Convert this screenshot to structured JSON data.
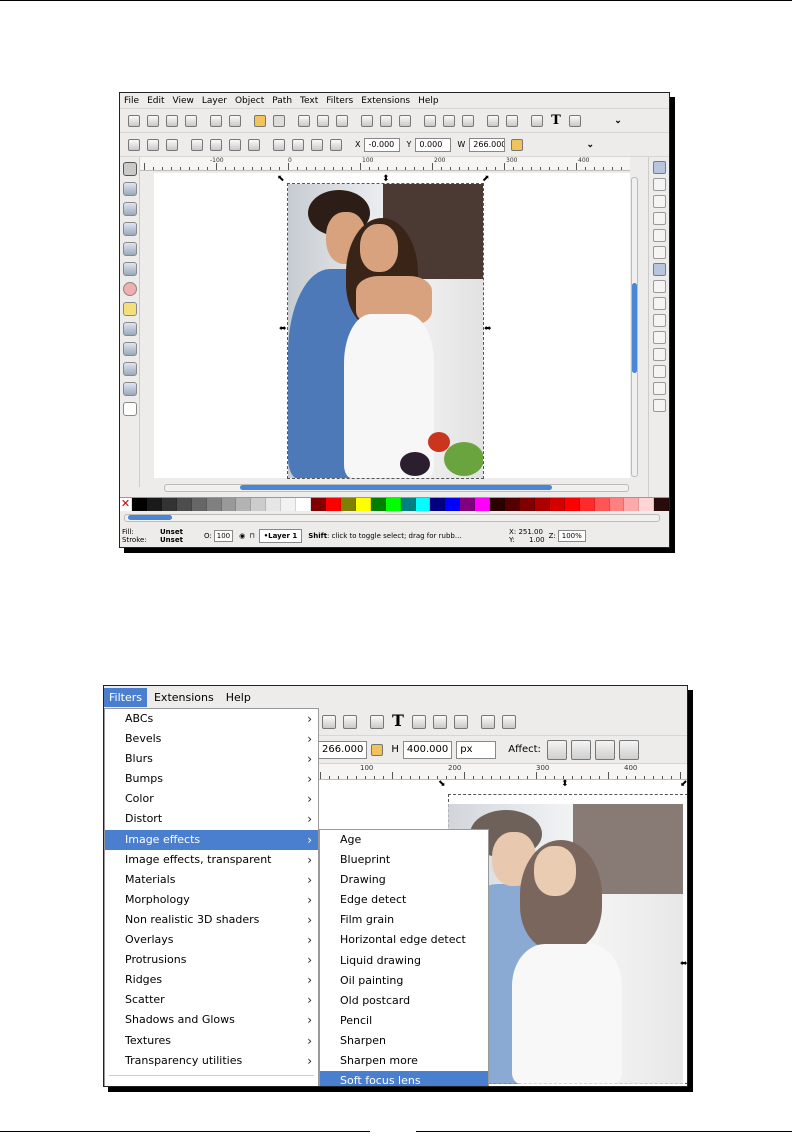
{
  "figure1": {
    "menu": [
      "File",
      "Edit",
      "View",
      "Layer",
      "Object",
      "Path",
      "Text",
      "Filters",
      "Extensions",
      "Help"
    ],
    "toolbar": {
      "x_label": "X",
      "x_value": "-0.000",
      "y_label": "Y",
      "y_value": "0.000",
      "w_label": "W",
      "w_value": "266.000"
    },
    "ruler_numbers": [
      "-100",
      "0",
      "100",
      "200",
      "300",
      "400"
    ],
    "status": {
      "fill_label": "Fill:",
      "fill_value": "Unset",
      "stroke_label": "Stroke:",
      "stroke_value": "Unset",
      "opacity_label": "O:",
      "opacity_value": "100",
      "layer": "•Layer 1",
      "message_bold": "Shift",
      "message": ": click to toggle select; drag for rubb...",
      "x_label": "X:",
      "x_value": "251.00",
      "y_label": "Y:",
      "y_value": "1.00",
      "zoom_label": "Z:",
      "zoom_value": "100%"
    },
    "palette": [
      "#000000",
      "#1a1a1a",
      "#333333",
      "#4d4d4d",
      "#666666",
      "#808080",
      "#999999",
      "#b3b3b3",
      "#cccccc",
      "#e6e6e6",
      "#f2f2f2",
      "#ffffff",
      "#800000",
      "#ff0000",
      "#808000",
      "#ffff00",
      "#008000",
      "#00ff00",
      "#008080",
      "#00ffff",
      "#000080",
      "#0000ff",
      "#800080",
      "#ff00ff",
      "#2b0000",
      "#550000",
      "#800000",
      "#aa0000",
      "#d40000",
      "#ff0000",
      "#ff2a2a",
      "#ff5555",
      "#ff8080",
      "#ffaaaa",
      "#ffd5d5",
      "#280b0b"
    ]
  },
  "figure2": {
    "menu": [
      "Filters",
      "Extensions",
      "Help"
    ],
    "toolbar": {
      "w_value": "266.000",
      "h_label": "H",
      "h_value": "400.000",
      "unit": "px",
      "affect_label": "Affect:"
    },
    "ruler_numbers": [
      "100",
      "200",
      "300",
      "400"
    ],
    "filters_menu": [
      {
        "label": "ABCs",
        "sub": true
      },
      {
        "label": "Bevels",
        "sub": true
      },
      {
        "label": "Blurs",
        "sub": true
      },
      {
        "label": "Bumps",
        "sub": true
      },
      {
        "label": "Color",
        "sub": true
      },
      {
        "label": "Distort",
        "sub": true
      },
      {
        "label": "Image effects",
        "sub": true,
        "highlighted": true
      },
      {
        "label": "Image effects, transparent",
        "sub": true
      },
      {
        "label": "Materials",
        "sub": true
      },
      {
        "label": "Morphology",
        "sub": true
      },
      {
        "label": "Non realistic 3D shaders",
        "sub": true
      },
      {
        "label": "Overlays",
        "sub": true
      },
      {
        "label": "Protrusions",
        "sub": true
      },
      {
        "label": "Ridges",
        "sub": true
      },
      {
        "label": "Scatter",
        "sub": true
      },
      {
        "label": "Shadows and Glows",
        "sub": true
      },
      {
        "label": "Textures",
        "sub": true
      },
      {
        "label": "Transparency utilities",
        "sub": true
      }
    ],
    "image_effects_submenu": [
      "Age",
      "Blueprint",
      "Drawing",
      "Edge detect",
      "Film grain",
      "Horizontal edge detect",
      "Liquid drawing",
      "Oil painting",
      "Old postcard",
      "Pencil",
      "Sharpen",
      "Sharpen more",
      "Soft focus lens"
    ],
    "submenu_highlighted": "Soft focus lens",
    "highlight_color": "#4a7fd0"
  }
}
